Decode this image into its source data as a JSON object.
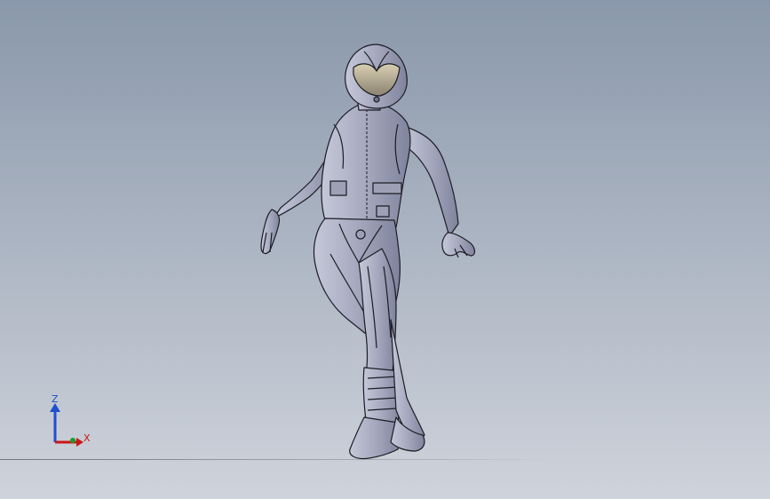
{
  "viewport": {
    "background_top": "#8a98ab",
    "background_bottom": "#cfd3db",
    "model_fill": "#a7aabf",
    "model_edge": "#1c1c24"
  },
  "model": {
    "icon": "female-figure-3d-model"
  },
  "triad": {
    "z_label": "Z",
    "x_label": "X",
    "z_color": "#1e4fd0",
    "x_color": "#c81818",
    "y_color": "#1f9a2a"
  }
}
